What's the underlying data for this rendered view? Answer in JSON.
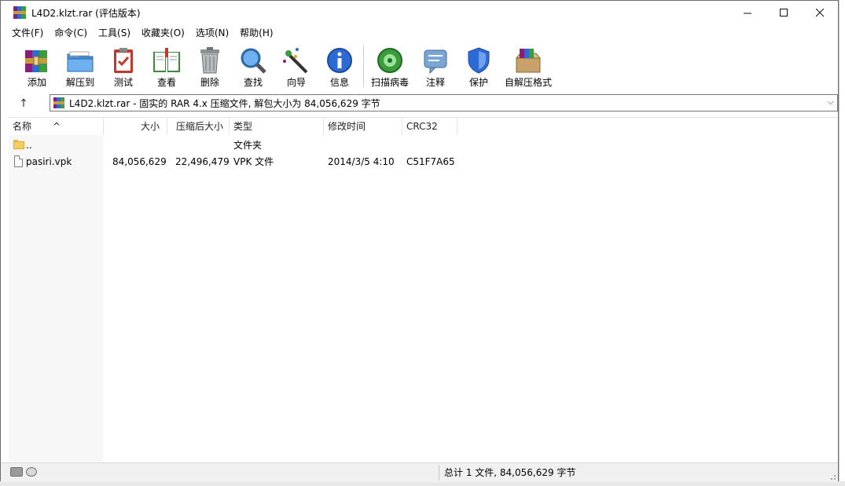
{
  "window": {
    "title": "L4D2.klzt.rar (评估版本)"
  },
  "controls": {
    "minimize": "—",
    "maximize": "☐",
    "close": "✕"
  },
  "menu": [
    "文件(F)",
    "命令(C)",
    "工具(S)",
    "收藏夹(O)",
    "选项(N)",
    "帮助(H)"
  ],
  "toolbar": [
    {
      "label": "添加",
      "icon": "add-archive-icon"
    },
    {
      "label": "解压到",
      "icon": "extract-to-icon"
    },
    {
      "label": "测试",
      "icon": "test-icon"
    },
    {
      "label": "查看",
      "icon": "view-book-icon"
    },
    {
      "label": "删除",
      "icon": "trash-icon"
    },
    {
      "label": "查找",
      "icon": "magnifier-icon"
    },
    {
      "label": "向导",
      "icon": "wizard-wand-icon"
    },
    {
      "label": "信息",
      "icon": "info-icon"
    },
    {
      "label": "扫描病毒",
      "icon": "virus-scan-icon"
    },
    {
      "label": "注释",
      "icon": "comment-icon"
    },
    {
      "label": "保护",
      "icon": "shield-icon"
    },
    {
      "label": "自解压格式",
      "icon": "sfx-box-icon"
    }
  ],
  "address": {
    "up": "↑",
    "path": "L4D2.klzt.rar - 固实的 RAR 4.x 压缩文件, 解包大小为 84,056,629 字节",
    "dropdown": "⌵"
  },
  "columns": {
    "name": "名称",
    "size": "大小",
    "packed": "压缩后大小",
    "type": "类型",
    "modified": "修改时间",
    "crc": "CRC32",
    "sort_indicator": "^"
  },
  "rows": [
    {
      "name": "..",
      "size": "",
      "packed": "",
      "type": "文件夹",
      "modified": "",
      "crc": "",
      "icon": "folder-icon"
    },
    {
      "name": "pasiri.vpk",
      "size": "84,056,629",
      "packed": "22,496,479",
      "type": "VPK 文件",
      "modified": "2014/3/5 4:10",
      "crc": "C51F7A65",
      "icon": "file-icon"
    }
  ],
  "status": {
    "summary": "总计 1 文件, 84,056,629 字节"
  }
}
